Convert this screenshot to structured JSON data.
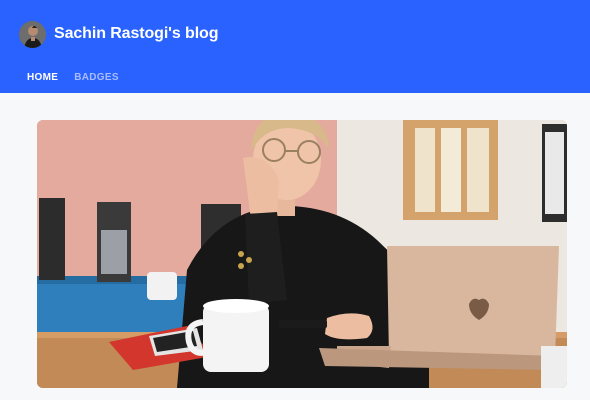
{
  "header": {
    "blog_title": "Sachin Rastogi's blog",
    "colors": {
      "background": "#2962ff",
      "title": "#ffffff",
      "nav_active": "#ffffff",
      "nav_inactive": "#a9bcff"
    }
  },
  "nav": {
    "items": [
      {
        "label": "HOME",
        "active": true
      },
      {
        "label": "BADGES",
        "active": false
      }
    ]
  },
  "page": {
    "background": "#f7f8fa"
  },
  "hero": {
    "subject": "woman with glasses at a desk with a laptop, coffee mug, phone and red notebook"
  }
}
